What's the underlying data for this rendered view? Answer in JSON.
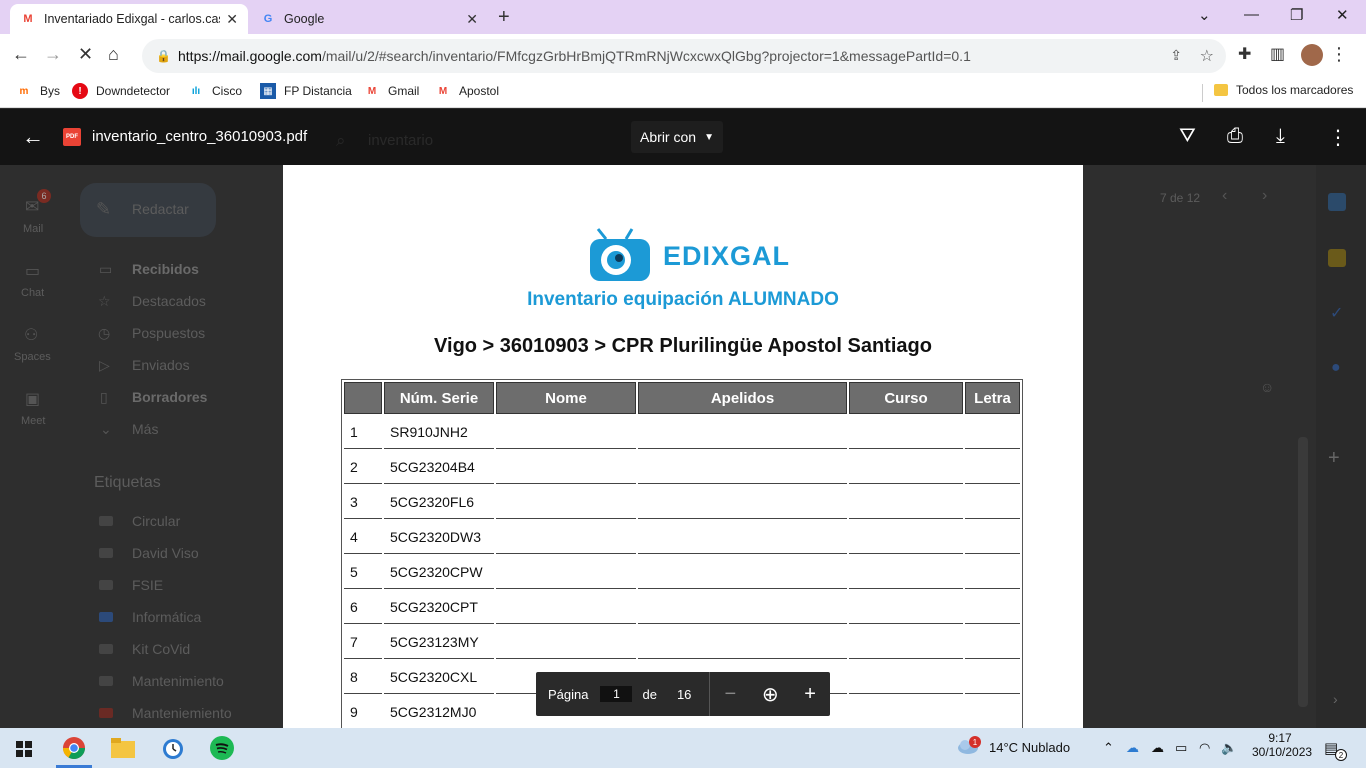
{
  "tabs": [
    {
      "title": "Inventariado Edixgal - carlos.cas",
      "favicon": "gmail-icon",
      "active": true
    },
    {
      "title": "Google",
      "favicon": "google-icon",
      "active": false
    }
  ],
  "window_controls": {
    "minimize": "—",
    "maximize": "❐",
    "close": "✕",
    "list": "⌄"
  },
  "toolbar": {
    "url_host": "https://mail.google.com",
    "url_rest": "/mail/u/2/#search/inventario/FMfcgzGrbHrBmjQTRmRNjWcxcwxQlGbg?projector=1&messagePartId=0.1"
  },
  "bookmarks": [
    {
      "label": "Bys",
      "icon": "m-logo-icon",
      "color": "#ff6a00"
    },
    {
      "label": "Downdetector",
      "icon": "alert-icon",
      "color": "#e50914"
    },
    {
      "label": "Cisco",
      "icon": "cisco-icon",
      "color": "#049fd9"
    },
    {
      "label": "FP Distancia",
      "icon": "fp-icon",
      "color": "#1a5aa8"
    },
    {
      "label": "Gmail",
      "icon": "gmail-icon",
      "color": "#ea4335"
    },
    {
      "label": "Apostol",
      "icon": "gmail-icon",
      "color": "#ea4335"
    }
  ],
  "bookmarks_all": "Todos los marcadores",
  "gmail_bg": {
    "search": "inventario",
    "rail": [
      {
        "label": "Mail",
        "badge": "6"
      },
      {
        "label": "Chat"
      },
      {
        "label": "Spaces"
      },
      {
        "label": "Meet"
      }
    ],
    "compose": "Redactar",
    "nav": [
      "Recibidos",
      "Destacados",
      "Pospuestos",
      "Enviados",
      "Borradores",
      "Más"
    ],
    "labels_title": "Etiquetas",
    "labels": [
      "Circular",
      "David Viso",
      "FSIE",
      "Informática",
      "Kit CoVid",
      "Mantenimiento",
      "Manteniemiento"
    ],
    "pager": "7 de 12"
  },
  "viewer": {
    "filename": "inventario_centro_36010903.pdf",
    "open_with": "Abrir con",
    "pdf_badge": "PDF"
  },
  "document": {
    "brand": "EDIXGAL",
    "subtitle": "Inventario equipación ALUMNADO",
    "path": "Vigo > 36010903 > CPR Plurilingüe Apostol Santiago",
    "columns": [
      "",
      "Núm. Serie",
      "Nome",
      "Apelidos",
      "Curso",
      "Letra"
    ],
    "rows": [
      {
        "n": "1",
        "serial": "SR910JNH2"
      },
      {
        "n": "2",
        "serial": "5CG23204B4"
      },
      {
        "n": "3",
        "serial": "5CG2320FL6"
      },
      {
        "n": "4",
        "serial": "5CG2320DW3"
      },
      {
        "n": "5",
        "serial": "5CG2320CPW"
      },
      {
        "n": "6",
        "serial": "5CG2320CPT"
      },
      {
        "n": "7",
        "serial": "5CG23123MY"
      },
      {
        "n": "8",
        "serial": "5CG2320CXL"
      },
      {
        "n": "9",
        "serial": "5CG2312MJ0"
      }
    ]
  },
  "page_control": {
    "label": "Página",
    "current": "1",
    "of": "de",
    "total": "16"
  },
  "taskbar": {
    "weather": "14°C  Nublado",
    "weather_badge": "1",
    "time": "9:17",
    "date": "30/10/2023",
    "notif_count": "2"
  }
}
